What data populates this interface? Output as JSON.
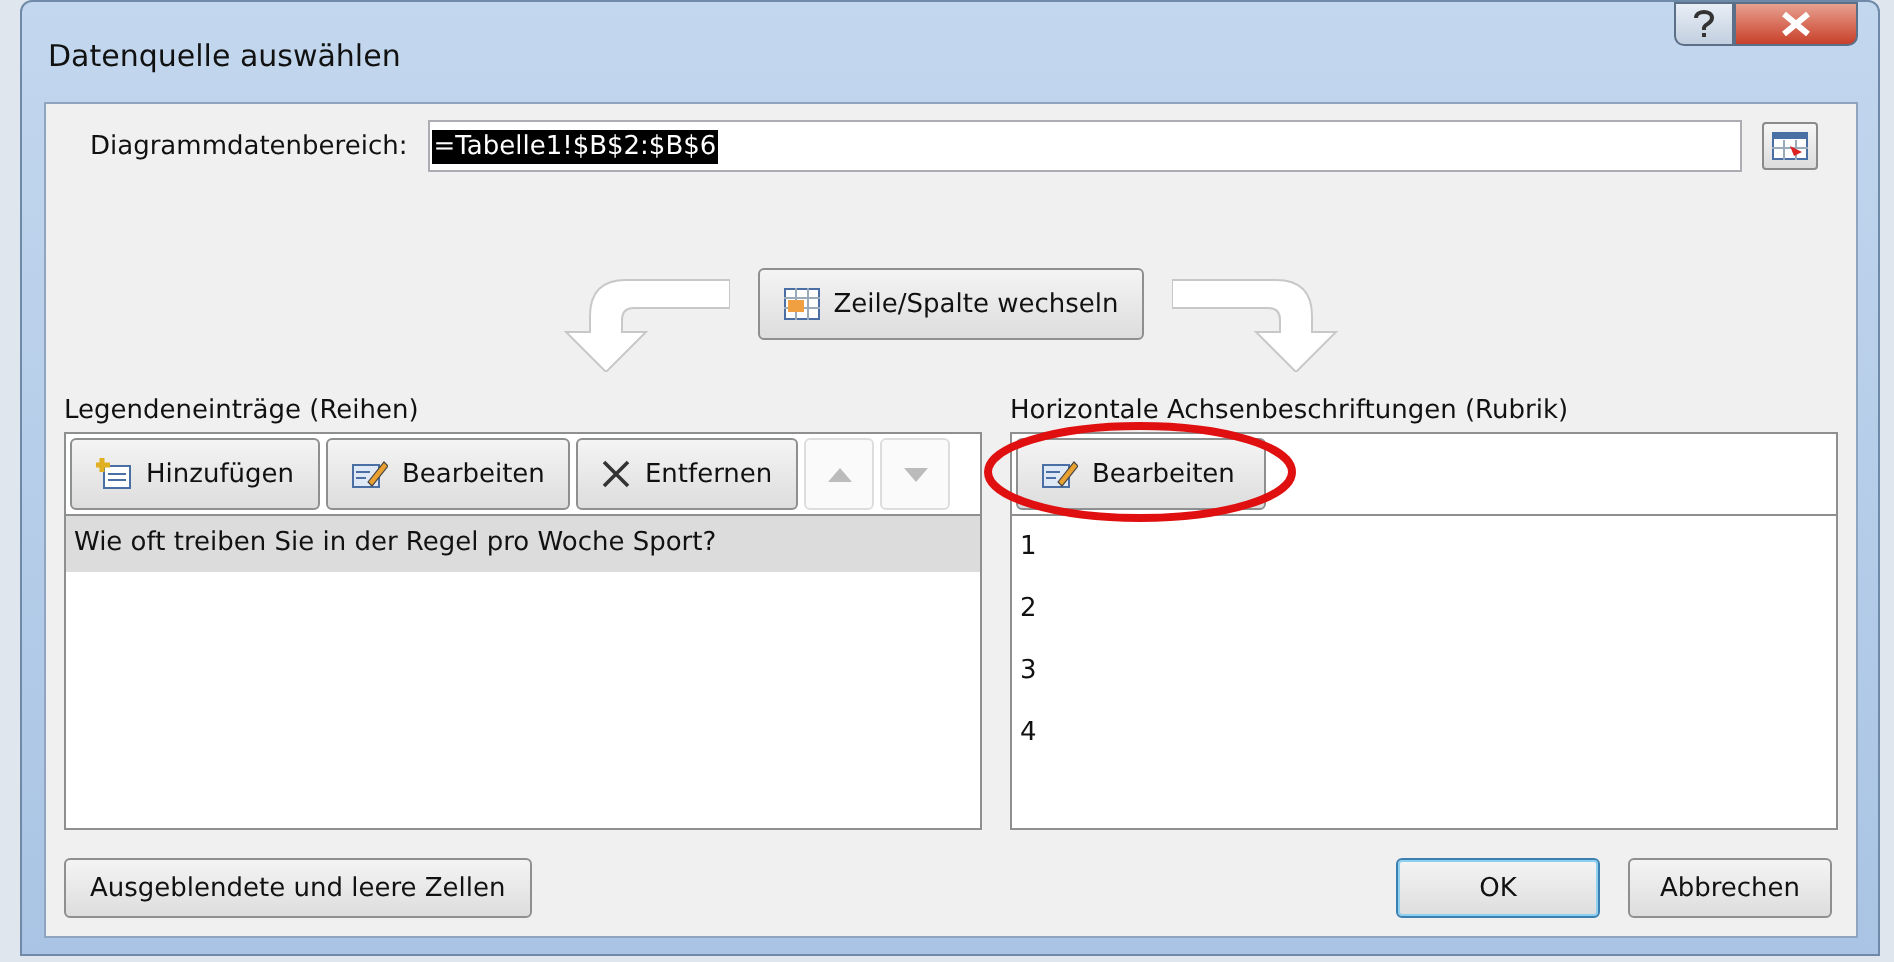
{
  "window": {
    "title": "Datenquelle auswählen"
  },
  "range": {
    "label": "Diagrammdatenbereich:",
    "value": "=Tabelle1!$B$2:$B$6"
  },
  "switch_button": {
    "label": "Zeile/Spalte wechseln"
  },
  "series_panel": {
    "title": "Legendeneinträge (Reihen)",
    "buttons": [
      {
        "kind": "add",
        "label": "Hinzufügen"
      },
      {
        "kind": "edit",
        "label": "Bearbeiten"
      },
      {
        "kind": "remove",
        "label": "Entfernen"
      }
    ],
    "move_buttons": [
      {
        "kind": "up",
        "disabled": true
      },
      {
        "kind": "down",
        "disabled": true
      }
    ],
    "items": [
      {
        "label": "Wie oft treiben Sie in der Regel pro Woche Sport?",
        "selected": true
      }
    ]
  },
  "category_panel": {
    "title": "Horizontale Achsenbeschriftungen (Rubrik)",
    "buttons": [
      {
        "kind": "edit",
        "label": "Bearbeiten"
      }
    ],
    "items": [
      {
        "label": "1",
        "selected": false
      },
      {
        "label": "2",
        "selected": false
      },
      {
        "label": "3",
        "selected": false
      },
      {
        "label": "4",
        "selected": false
      }
    ]
  },
  "footer": {
    "hidden_cells_button": "Ausgeblendete und leere Zellen",
    "ok": "OK",
    "cancel": "Abbrechen"
  }
}
